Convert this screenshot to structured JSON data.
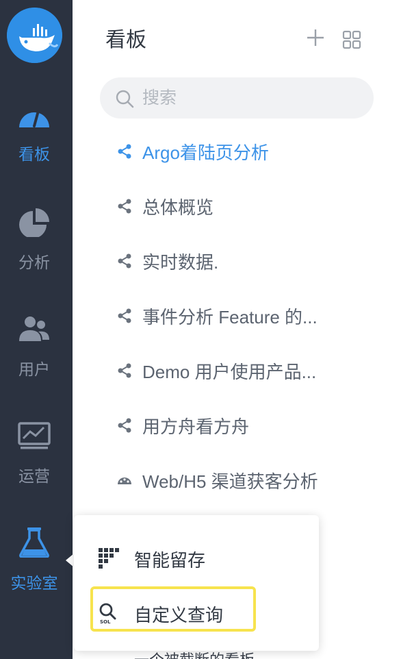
{
  "sidebar": {
    "logo_icon": "whale-logo-icon",
    "items": [
      {
        "label": "看板",
        "icon": "dashboard-gauge-icon",
        "active": true
      },
      {
        "label": "分析",
        "icon": "pie-chart-icon",
        "active": false
      },
      {
        "label": "用户",
        "icon": "users-icon",
        "active": false
      },
      {
        "label": "运营",
        "icon": "monitor-trend-icon",
        "active": false
      },
      {
        "label": "实验室",
        "icon": "flask-icon",
        "active": true
      }
    ]
  },
  "panel": {
    "title": "看板",
    "add_icon": "plus-icon",
    "grid_icon": "grid-icon"
  },
  "search": {
    "placeholder": "搜索",
    "icon": "search-icon"
  },
  "boards": [
    {
      "label": "Argo着陆页分析",
      "icon": "share-icon",
      "active": true
    },
    {
      "label": "总体概览",
      "icon": "share-icon",
      "active": false
    },
    {
      "label": "实时数据.",
      "icon": "share-icon",
      "active": false
    },
    {
      "label": "事件分析 Feature 的...",
      "icon": "share-icon",
      "active": false
    },
    {
      "label": "Demo 用户使用产品...",
      "icon": "share-icon",
      "active": false
    },
    {
      "label": "用方舟看方舟",
      "icon": "share-icon",
      "active": false
    },
    {
      "label": "Web/H5 渠道获客分析",
      "icon": "palette-icon",
      "active": false
    }
  ],
  "popup": {
    "items": [
      {
        "label": "智能留存",
        "icon": "retention-grid-icon"
      },
      {
        "label": "自定义查询",
        "icon": "sql-search-icon",
        "highlighted": true
      }
    ],
    "peek_text": "一个被截断的看板"
  },
  "colors": {
    "sidebar_bg": "#2b3240",
    "accent": "#3d93e8",
    "highlight": "#f7e34e"
  }
}
